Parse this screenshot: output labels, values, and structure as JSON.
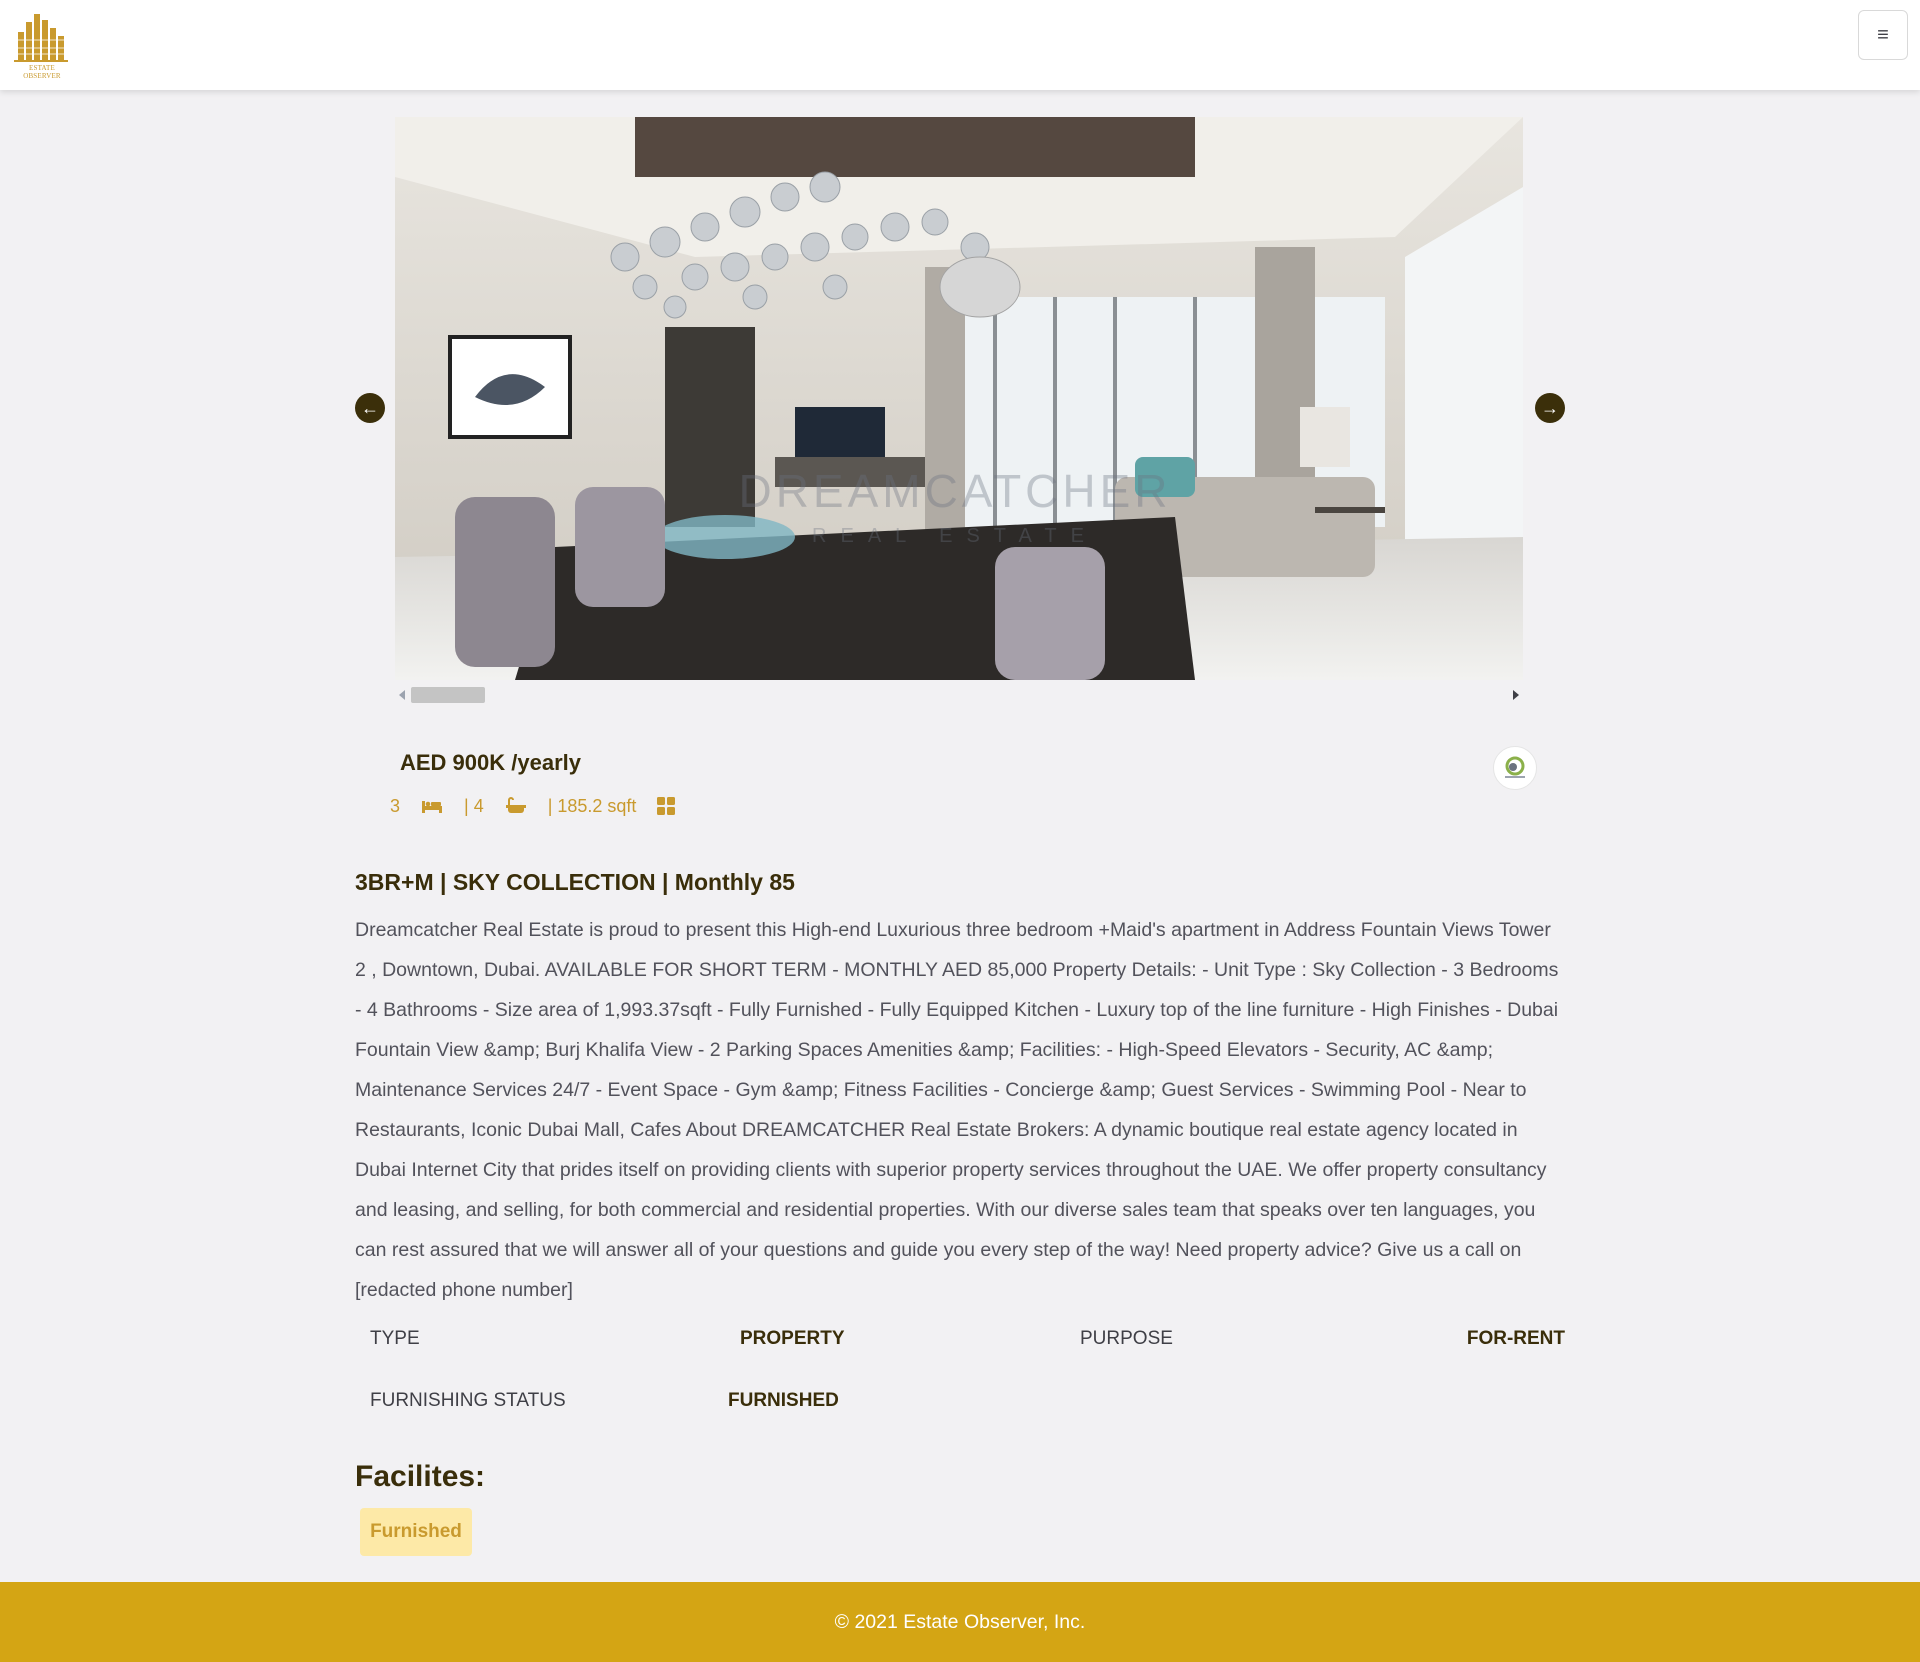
{
  "header": {
    "logo_text": "ESTATE OBSERVER",
    "menu_icon": "hamburger-icon"
  },
  "carousel": {
    "prev_icon": "arrow-left-icon",
    "next_icon": "arrow-right-icon",
    "watermark": "DREAMCATCHER",
    "watermark_sub": "REAL ESTATE"
  },
  "listing": {
    "price": "AED 900K /yearly",
    "bedrooms": "3",
    "bathrooms": "| 4",
    "area": "| 185.2 sqft",
    "title": "3BR+M | SKY COLLECTION | Monthly 85",
    "description": "Dreamcatcher Real Estate is proud to present this High-end Luxurious three bedroom +Maid's apartment in Address Fountain Views Tower 2 , Downtown, Dubai. AVAILABLE FOR SHORT TERM - MONTHLY AED 85,000 Property Details: - Unit Type : Sky Collection - 3 Bedrooms - 4 Bathrooms - Size area of 1,993.37sqft - Fully Furnished - Fully Equipped Kitchen - Luxury top of the line furniture - High Finishes - Dubai Fountain View &amp; Burj Khalifa View - 2 Parking Spaces Amenities &amp; Facilities: - High-Speed Elevators - Security, AC &amp; Maintenance Services 24/7 - Event Space - Gym &amp; Fitness Facilities - Concierge &amp; Guest Services - Swimming Pool - Near to Restaurants, Iconic Dubai Mall, Cafes About DREAMCATCHER Real Estate Brokers: A dynamic boutique real estate agency located in Dubai Internet City that prides itself on providing clients with superior property services throughout the UAE. We offer property consultancy and leasing, and selling, for both commercial and residential properties. With our diverse sales team that speaks over ten languages, you can rest assured that we will answer all of your questions and guide you every step of the way! Need property advice? Give us a call on [redacted phone number]"
  },
  "info": {
    "type_label": "TYPE",
    "type_value": "PROPERTY",
    "purpose_label": "PURPOSE",
    "purpose_value": "FOR-RENT",
    "furnishing_label": "FURNISHING STATUS",
    "furnishing_value": "FURNISHED"
  },
  "facilities": {
    "title": "Facilites:",
    "items": [
      "Furnished"
    ]
  },
  "footer": {
    "copyright": "© 2021 Estate Observer, Inc."
  },
  "colors": {
    "accent": "#c99a2e",
    "footer_bg": "#d4a514",
    "heading": "#3a2e0a",
    "badge_bg": "#fde9a7"
  }
}
